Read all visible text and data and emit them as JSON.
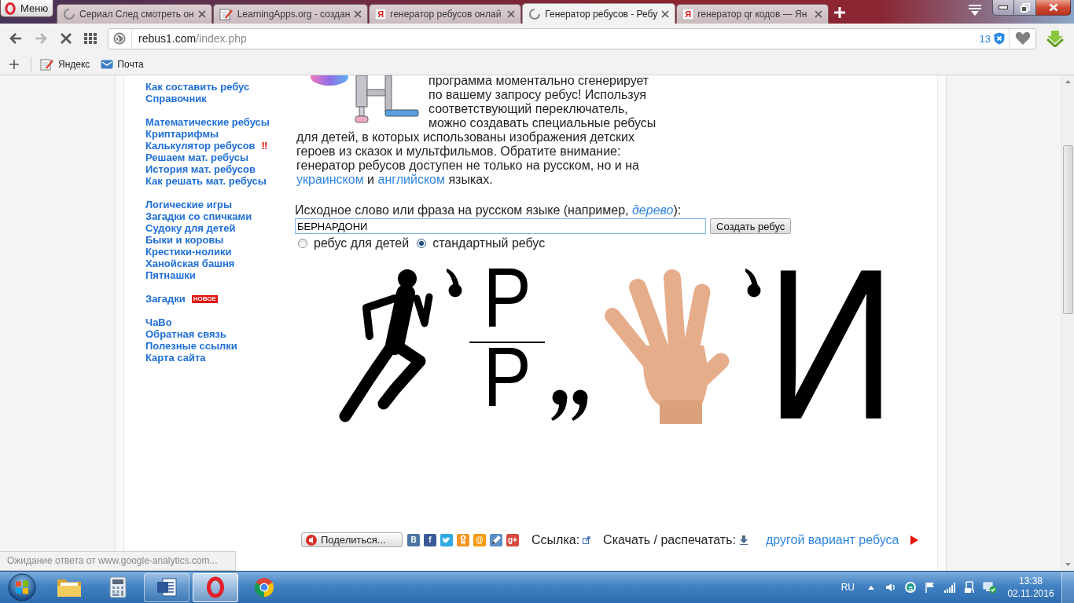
{
  "browser": {
    "menu_label": "Меню",
    "tabs": [
      {
        "title": "Сериал След смотреть он",
        "kind": "loading",
        "selected": false
      },
      {
        "title": "LearningApps.org - создан",
        "kind": "notepad",
        "selected": false
      },
      {
        "title": "генератор ребусов онлай",
        "kind": "letter",
        "icon_letter": "Я",
        "selected": false
      },
      {
        "title": "Генератор ребусов - Ребу",
        "kind": "loading",
        "selected": true
      },
      {
        "title": "генератор qr кодов — Ян",
        "kind": "letter",
        "icon_letter": "Я",
        "selected": false
      }
    ],
    "nav": [
      {
        "kind": "back",
        "disabled": false
      },
      {
        "kind": "forward",
        "disabled": true
      },
      {
        "kind": "stop",
        "disabled": false
      },
      {
        "kind": "grid",
        "disabled": false
      }
    ],
    "address": {
      "host": "rebus1.com",
      "path": "/index.php",
      "blocked_count": "13"
    },
    "bookmarks": [
      {
        "label": "Яндекс",
        "kind": "notepad"
      },
      {
        "label": "Почта",
        "kind": "mail"
      }
    ]
  },
  "sidebar": {
    "groups": [
      {
        "links": [
          {
            "label": "Как составить ребус"
          },
          {
            "label": "Справочник"
          }
        ]
      },
      {
        "links": [
          {
            "label": "Математические ребусы"
          },
          {
            "label": "Криптарифмы"
          },
          {
            "label": "Калькулятор ребусов",
            "mark": "‼"
          },
          {
            "label": "Решаем мат. ребусы"
          },
          {
            "label": "История мат. ребусов"
          },
          {
            "label": "Как решать мат. ребусы"
          }
        ]
      },
      {
        "links": [
          {
            "label": "Логические игры"
          },
          {
            "label": "Загадки со спичками"
          },
          {
            "label": "Судоку для детей"
          },
          {
            "label": "Быки и коровы"
          },
          {
            "label": "Крестики-нолики"
          },
          {
            "label": "Ханойская башня"
          },
          {
            "label": "Пятнашки"
          }
        ]
      },
      {
        "links": [
          {
            "label": "Загадки",
            "badge": "НОВОЕ"
          }
        ]
      },
      {
        "links": [
          {
            "label": "ЧаВо"
          },
          {
            "label": "Обратная связь"
          },
          {
            "label": "Полезные ссылки"
          },
          {
            "label": "Карта сайта"
          }
        ]
      }
    ]
  },
  "intro": {
    "blocks": [
      {
        "parts": [
          {
            "kind": "text",
            "text": "программа моментально сгенерирует по вашему запросу ребус! Используя соответствующий переключатель, можно создавать специальные ребусы"
          }
        ]
      },
      {
        "parts": [
          {
            "kind": "text",
            "text": "для детей, в которых использованы изображения детских героев из сказок и мультфильмов. Обратите внимание: генератор ребусов доступен не только на русском, но и на "
          },
          {
            "kind": "link",
            "text": "украинском"
          },
          {
            "kind": "text",
            "text": " и "
          },
          {
            "kind": "link",
            "text": "английском"
          },
          {
            "kind": "text",
            "text": " языках."
          }
        ]
      }
    ]
  },
  "form": {
    "label": "Исходное слово или фраза на русском языке (например, ",
    "example": "дерево",
    "label_end": "):",
    "value": "БЕРНАРДОНИ",
    "button": "Создать ребус",
    "options": [
      {
        "label": "ребус для детей",
        "selected": false
      },
      {
        "label": "стандартный ребус",
        "selected": true
      }
    ]
  },
  "rebus": {
    "items": [
      {
        "kind": "runner"
      },
      {
        "kind": "apostrophe"
      },
      {
        "kind": "fraction",
        "top": "Р",
        "bottom": "Р"
      },
      {
        "kind": "commas"
      },
      {
        "kind": "hand"
      },
      {
        "kind": "apostrophe"
      },
      {
        "kind": "letter",
        "text": "И"
      }
    ]
  },
  "share": {
    "button": "Поделиться...",
    "networks": [
      {
        "kind": "letter",
        "glyph": "В",
        "color": "#4c75a3"
      },
      {
        "kind": "letter",
        "glyph": "f",
        "color": "#3b5998"
      },
      {
        "kind": "bird",
        "color": "#2fa9e1"
      },
      {
        "kind": "person",
        "color": "#f4931f"
      },
      {
        "kind": "letter",
        "glyph": "@",
        "color": "#f59a0b"
      },
      {
        "kind": "pencil",
        "color": "#5b8fc7"
      },
      {
        "kind": "letter",
        "glyph": "g+",
        "color": "#d54b3d"
      }
    ],
    "link_label": "Ссылка:",
    "download_label": "Скачать / распечатать:",
    "next_link": "другой вариант ребуса"
  },
  "status_text": "Ожидание ответа от www.google-analytics.com...",
  "taskbar": {
    "apps": [
      {
        "kind": "folder",
        "open": false,
        "active": false
      },
      {
        "kind": "calculator",
        "open": false,
        "active": false
      },
      {
        "kind": "document",
        "open": true,
        "active": false
      },
      {
        "kind": "ring",
        "open": true,
        "active": true
      },
      {
        "kind": "wheel",
        "open": false,
        "active": false
      }
    ],
    "language": "RU",
    "time": "13:38",
    "date": "02.11.2016"
  }
}
